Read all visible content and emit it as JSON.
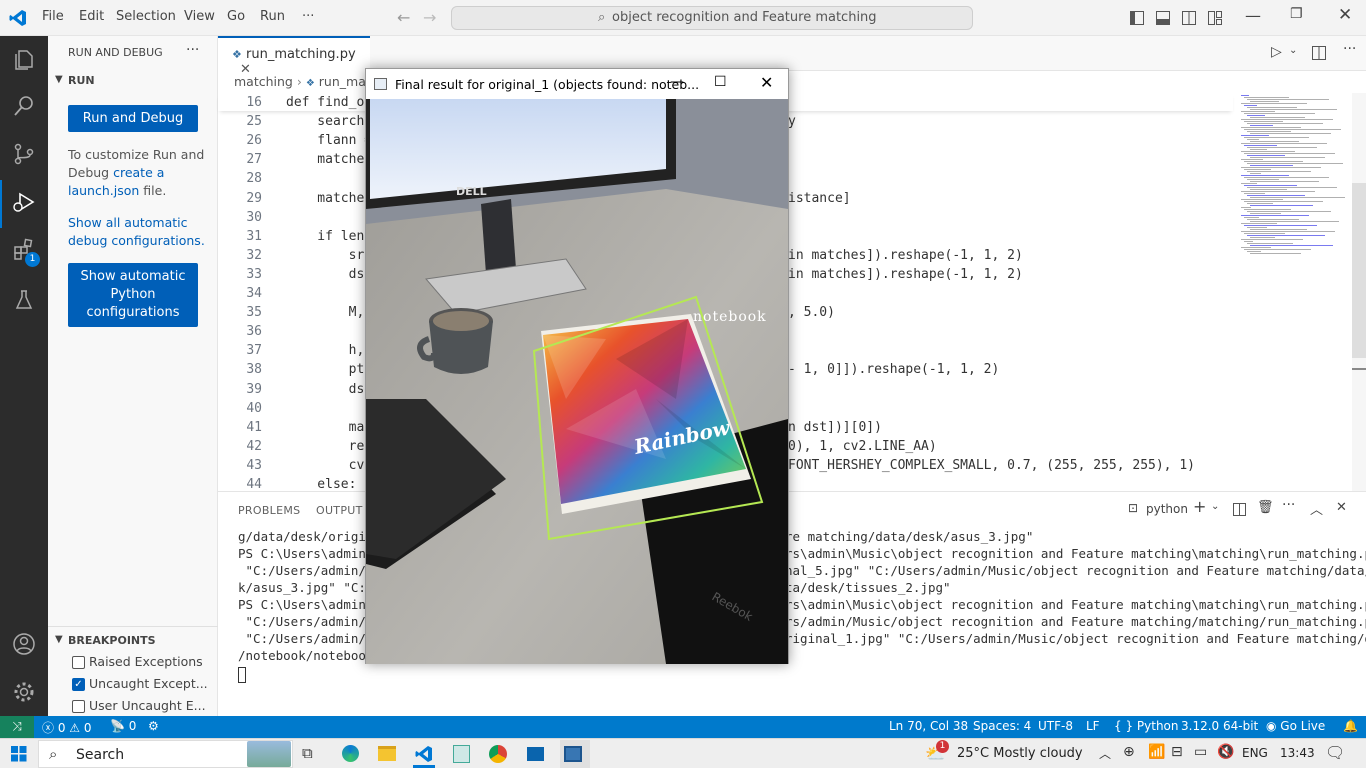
{
  "titlebar": {
    "menus": [
      "File",
      "Edit",
      "Selection",
      "View",
      "Go",
      "Run",
      "···"
    ],
    "command_center": "object recognition and Feature matching"
  },
  "sidebar": {
    "header": "RUN AND DEBUG",
    "section": "RUN",
    "run_button": "Run and Debug",
    "customize_text_1": "To customize Run and",
    "customize_text_2": "Debug",
    "customize_link_1": "create a",
    "customize_link_2": "launch.json",
    "customize_text_3": "file.",
    "show_all_1": "Show all automatic",
    "show_all_2": "debug configurations.",
    "python_btn_1": "Show automatic",
    "python_btn_2": "Python",
    "python_btn_3": "configurations",
    "breakpoints_header": "BREAKPOINTS",
    "breakpoints": [
      {
        "label": "Raised Exceptions",
        "checked": false
      },
      {
        "label": "Uncaught Except...",
        "checked": true
      },
      {
        "label": "User Uncaught E...",
        "checked": false
      }
    ],
    "extensions_badge": "1"
  },
  "editor": {
    "tab_label": "run_matching.py",
    "breadcrumb_1": "matching",
    "breadcrumb_2": "run_ma",
    "lines": [
      {
        "n": "16",
        "t": "def find_ob"
      },
      {
        "n": "25",
        "t": "    search"
      },
      {
        "n": "26",
        "t": "    flann ="
      },
      {
        "n": "27",
        "t": "    matche"
      },
      {
        "n": "28",
        "t": ""
      },
      {
        "n": "29",
        "t": "    matche"
      },
      {
        "n": "30",
        "t": ""
      },
      {
        "n": "31",
        "t": "    if len"
      },
      {
        "n": "32",
        "t": "        sr"
      },
      {
        "n": "33",
        "t": "        ds"
      },
      {
        "n": "34",
        "t": ""
      },
      {
        "n": "35",
        "t": "        M,"
      },
      {
        "n": "36",
        "t": ""
      },
      {
        "n": "37",
        "t": "        h,"
      },
      {
        "n": "38",
        "t": "        pt"
      },
      {
        "n": "39",
        "t": "        ds"
      },
      {
        "n": "40",
        "t": ""
      },
      {
        "n": "41",
        "t": "        ma"
      },
      {
        "n": "42",
        "t": "        re"
      },
      {
        "n": "43",
        "t": "        cv"
      },
      {
        "n": "44",
        "t": "    else:"
      }
    ],
    "right_fragments": [
      {
        "row": 1,
        "t": "y"
      },
      {
        "row": 5,
        "t": "istance]"
      },
      {
        "row": 8,
        "t": "in matches]).reshape(-1, 1, 2)"
      },
      {
        "row": 9,
        "t": "in matches]).reshape(-1, 1, 2)"
      },
      {
        "row": 11,
        "t": ", 5.0)"
      },
      {
        "row": 14,
        "t": "- 1, 0]]).reshape(-1, 1, 2)"
      },
      {
        "row": 17,
        "t": "n dst])][0])"
      },
      {
        "row": 18,
        "t": "0), 1, cv2.LINE_AA)"
      },
      {
        "row": 19,
        "t": "FONT_HERSHEY_COMPLEX_SMALL, 0.7, (255, 255, 255), 1)"
      }
    ]
  },
  "panel": {
    "tabs": [
      "PROBLEMS",
      "OUTPUT"
    ],
    "terminal_label": "python",
    "left_lines": [
      "g/data/desk/origi",
      "PS C:\\Users\\admin\\",
      " \"C:/Users/admin/M",
      "k/asus_3.jpg\" \"C:/",
      "PS C:\\Users\\admin\\",
      " \"C:/Users/admin/M",
      " \"C:/Users/admin/M",
      "/notebook/notebook"
    ],
    "right_lines": [
      "re matching/data/desk/asus_3.jpg\"",
      "rs\\admin\\Music\\object recognition and Feature matching\\matching\\run_matching.py\"",
      "nal_5.jpg\" \"C:/Users/admin/Music/object recognition and Feature matching/data/des",
      "ta/desk/tissues_2.jpg\"",
      "rs\\admin\\Music\\object recognition and Feature matching\\matching\\run_matching.py\"",
      "rs/admin/Music/object recognition and Feature matching/matching/run_matching.py\"",
      "riginal_1.jpg\" \"C:/Users/admin/Music/object recognition and Feature matching/data",
      ""
    ]
  },
  "cv_window": {
    "title": "Final result for original_1 (objects found: noteb...",
    "label": "notebook",
    "brand": "Rainbow",
    "monitor_brand": "DELL",
    "bag_brand": "Reebok"
  },
  "statusbar": {
    "errors": "0",
    "warnings": "0",
    "ports": "0",
    "position": "Ln 70, Col 38",
    "spaces": "Spaces: 4",
    "encoding": "UTF-8",
    "eol": "LF",
    "language": "Python",
    "interpreter": "3.12.0 64-bit",
    "golive": "Go Live"
  },
  "taskbar": {
    "search": "Search",
    "weather": "25°C  Mostly cloudy",
    "weather_badge": "1",
    "lang": "ENG",
    "time": "13:43"
  },
  "colors": {
    "accent": "#005fb8",
    "statusbar": "#007acc",
    "activitybar": "#2c2c2c",
    "match_box": "#b5e853"
  }
}
